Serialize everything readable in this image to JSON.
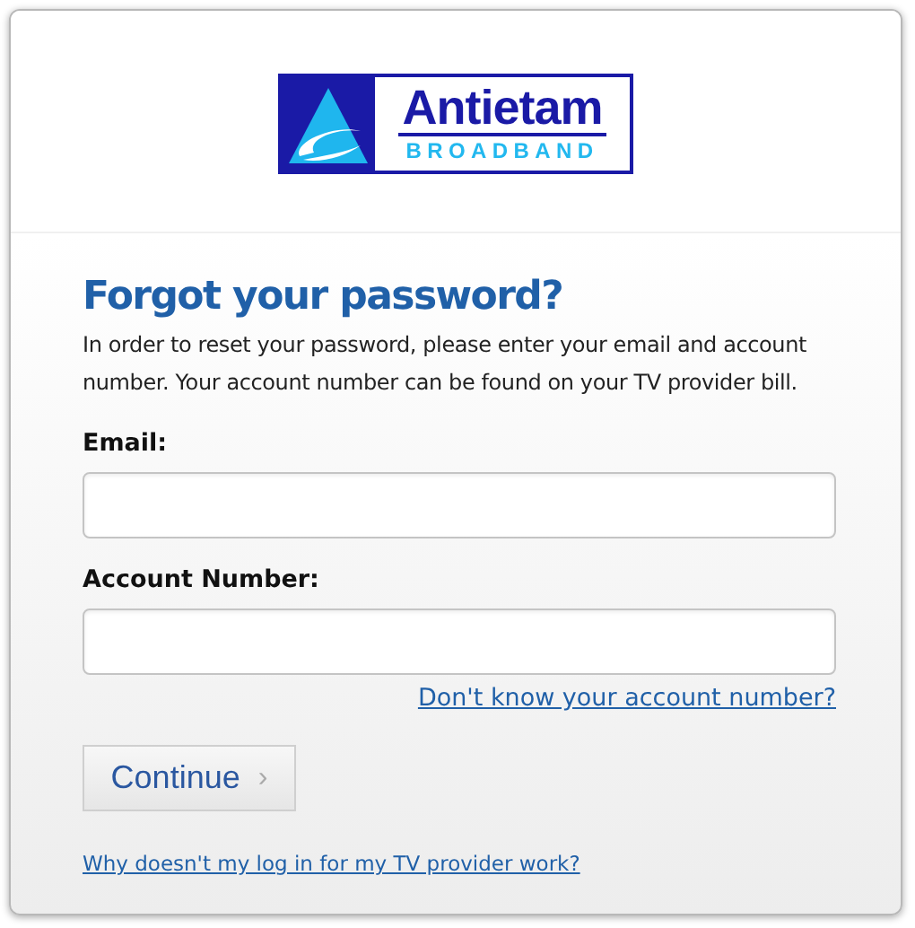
{
  "logo": {
    "name": "Antietam",
    "tagline": "BROADBAND"
  },
  "heading": "Forgot your password?",
  "intro": "In order to reset your password, please enter your email and account number. Your account number can be found on your TV provider bill.",
  "fields": [
    {
      "label": "Email:"
    },
    {
      "label": "Account Number:"
    }
  ],
  "help_link": "Don't know your account number?",
  "continue_button": {
    "label": "Continue",
    "chevron": "›"
  },
  "footer_link": "Why doesn't my log in for my TV provider work?"
}
